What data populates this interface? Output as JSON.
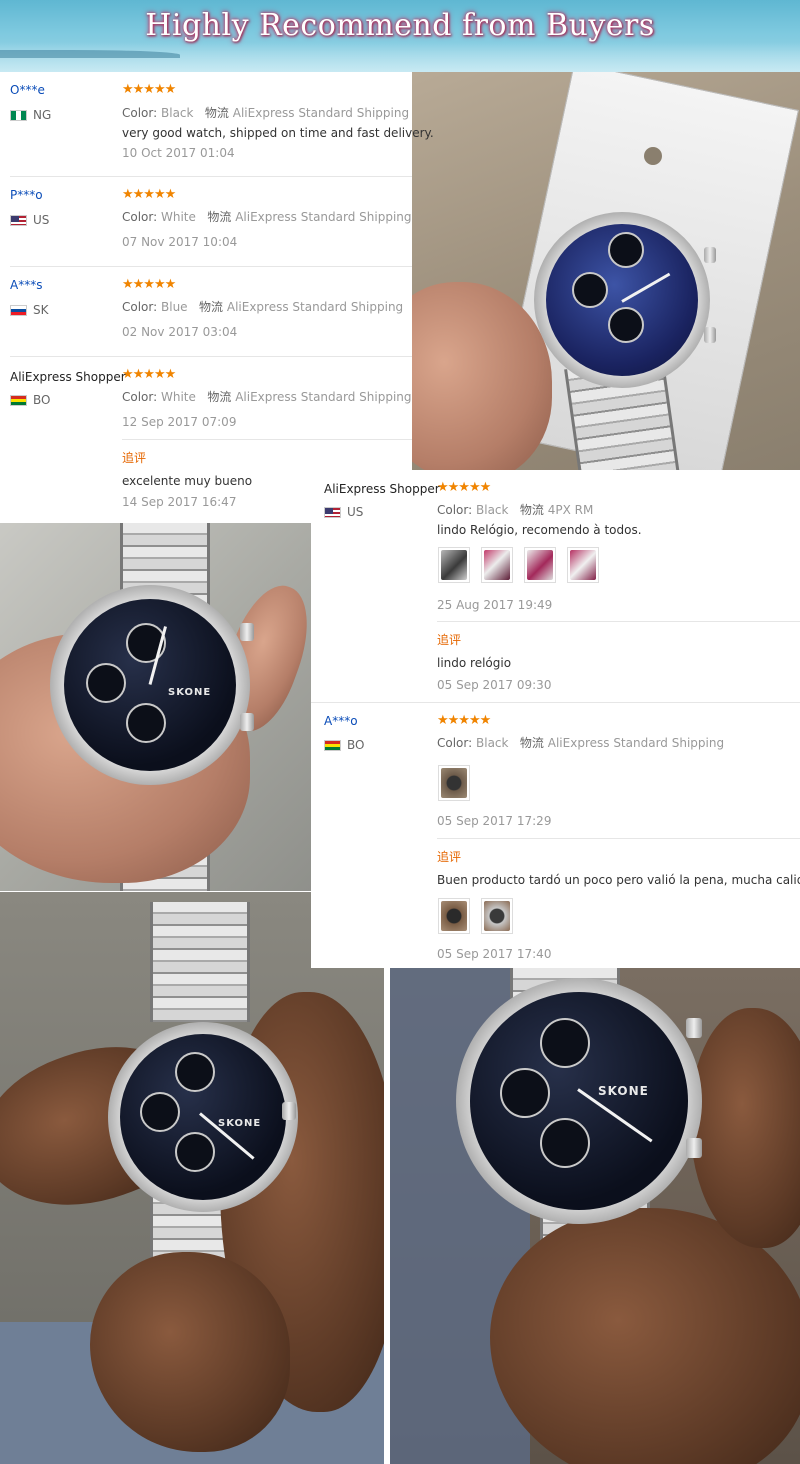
{
  "banner": {
    "title": "Highly Recommend from Buyers"
  },
  "labels": {
    "color": "Color:",
    "logistics": "物流",
    "additional_feedback": "追评"
  },
  "reviews_left": [
    {
      "user": "O***e",
      "country": "NG",
      "stars": "★★★★★",
      "color": "Black",
      "shipping": "AliExpress Standard Shipping",
      "text": "very good watch, shipped on time and fast delivery.",
      "date": "10 Oct 2017 01:04"
    },
    {
      "user": "P***o",
      "country": "US",
      "stars": "★★★★★",
      "color": "White",
      "shipping": "AliExpress Standard Shipping",
      "text": "",
      "date": "07 Nov 2017 10:04"
    },
    {
      "user": "A***s",
      "country": "SK",
      "stars": "★★★★★",
      "color": "Blue",
      "shipping": "AliExpress Standard Shipping",
      "text": "",
      "date": "02 Nov 2017 03:04"
    },
    {
      "user": "AliExpress Shopper",
      "country": "BO",
      "stars": "★★★★★",
      "color": "White",
      "shipping": "AliExpress Standard Shipping",
      "text": "",
      "date": "12 Sep 2017 07:09",
      "followup": {
        "text": "excelente muy bueno",
        "date": "14 Sep 2017 16:47"
      }
    }
  ],
  "reviews_right": [
    {
      "user": "AliExpress Shopper",
      "country": "US",
      "stars": "★★★★★",
      "color": "Black",
      "shipping": "4PX RM",
      "text": "lindo Relógio, recomendo à todos.",
      "date": "25 Aug 2017 19:49",
      "followup": {
        "text": "lindo relógio",
        "date": "05 Sep 2017 09:30"
      }
    },
    {
      "user": "A***o",
      "country": "BO",
      "stars": "★★★★★",
      "color": "Black",
      "shipping": "AliExpress Standard Shipping",
      "text": "",
      "date": "05 Sep 2017 17:29",
      "followup": {
        "text": "Buen producto tardó un poco pero valió la pena, mucha calidad",
        "date": "05 Sep 2017 17:40"
      }
    }
  ],
  "watch_brand": "SKONE",
  "colors": {
    "star": "#f08400",
    "link": "#0a4cb8",
    "followup": "#e56600"
  }
}
